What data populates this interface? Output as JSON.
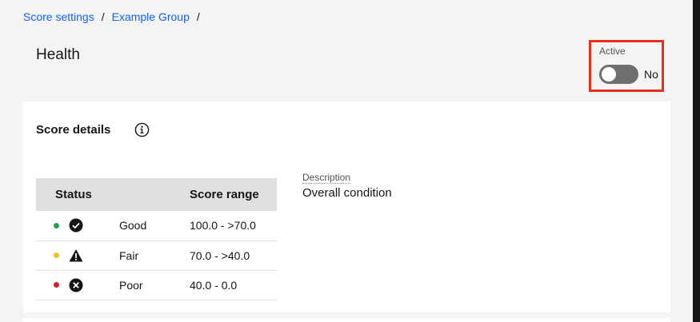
{
  "breadcrumb": {
    "items": [
      "Score settings",
      "Example Group"
    ],
    "separator": "/"
  },
  "page": {
    "title": "Health"
  },
  "toggle": {
    "label": "Active",
    "state": "No",
    "active": false
  },
  "score_details": {
    "title": "Score details",
    "info_icon": "info-icon",
    "table": {
      "headers": [
        "Status",
        "Score range"
      ],
      "rows": [
        {
          "label": "Good",
          "range": "100.0 - >70.0",
          "dot_color": "#24a148",
          "icon": "checkmark-filled-icon"
        },
        {
          "label": "Fair",
          "range": "70.0 - >40.0",
          "dot_color": "#f1c21b",
          "icon": "warning-filled-icon"
        },
        {
          "label": "Poor",
          "range": "40.0 - 0.0",
          "dot_color": "#da1e28",
          "icon": "error-filled-icon"
        }
      ]
    },
    "description": {
      "label": "Description",
      "value": "Overall condition"
    }
  },
  "colors": {
    "link": "#0f62fe",
    "highlight_border": "#e8301c",
    "good": "#24a148",
    "fair": "#f1c21b",
    "poor": "#da1e28"
  }
}
